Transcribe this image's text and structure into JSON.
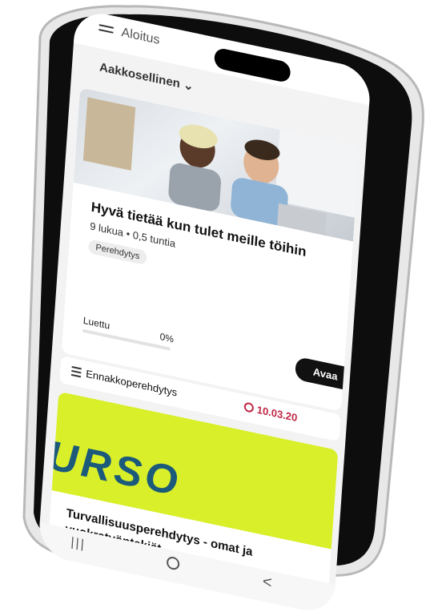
{
  "topbar": {
    "title": "Aloitus"
  },
  "sort": {
    "label": "Aakkosellinen",
    "chevron": "chevron-down-icon"
  },
  "card1": {
    "title": "Hyvä tietää kun tulet meille töihin",
    "meta": "9 lukua  •  0,5 tuntia",
    "tag": "Perehdytys",
    "read_label": "Luettu",
    "read_percent": "0%",
    "progress": 0,
    "open_button": "Avaa",
    "category": "Ennakkoperehdytys",
    "date": "10.03.20"
  },
  "card2": {
    "photo_text": "URSO",
    "title": "Turvallisuusperehdytys - omat ja vuokratvöntekiät"
  },
  "navbar": {
    "recents": "|||",
    "back": "<"
  },
  "colors": {
    "accent": "#c02645",
    "button": "#111111",
    "vest": "#d8ef2a",
    "vest_text": "#1b5a7a"
  }
}
